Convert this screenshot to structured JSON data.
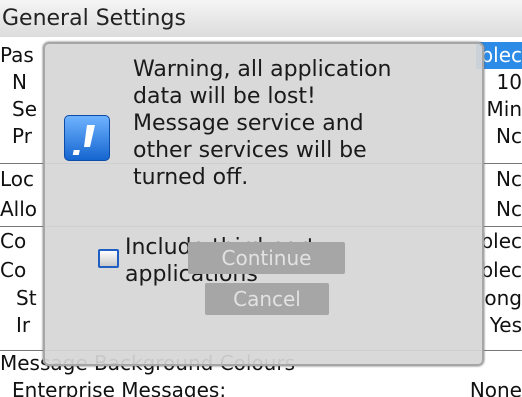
{
  "title": "General Settings",
  "settings_rows": [
    {
      "label": "Pas",
      "value": "blec",
      "selected": true
    },
    {
      "label": "N",
      "value": "10"
    },
    {
      "label": "Se",
      "value": "Min"
    },
    {
      "label": "Pr",
      "value": "Nc"
    },
    {
      "label": "Loc",
      "value": "Nc"
    },
    {
      "label": "Allo",
      "value": "Nc"
    },
    {
      "label": "Co",
      "value": "blec"
    },
    {
      "label": "Co",
      "value": "blec"
    },
    {
      "label": "St",
      "value": "ong"
    },
    {
      "label": "Ir",
      "value": "Yes"
    },
    {
      "label": "Message Background Colours",
      "value": ""
    },
    {
      "label": "Enterprise Messages:",
      "value": "None"
    }
  ],
  "dialog": {
    "message_lines": [
      "Warning, all application",
      "data will be lost!",
      "Message service and",
      "other services will be",
      "turned off."
    ],
    "checkbox_label_lines": [
      "Include third party",
      "applications"
    ],
    "checkbox_checked": false,
    "continue_label": "Continue",
    "cancel_label": "Cancel",
    "icon": "warning-exclamation-icon"
  },
  "colors": {
    "selection": "#2b8be6",
    "icon": "#1f6fd6",
    "button": "#a6a6a6"
  }
}
